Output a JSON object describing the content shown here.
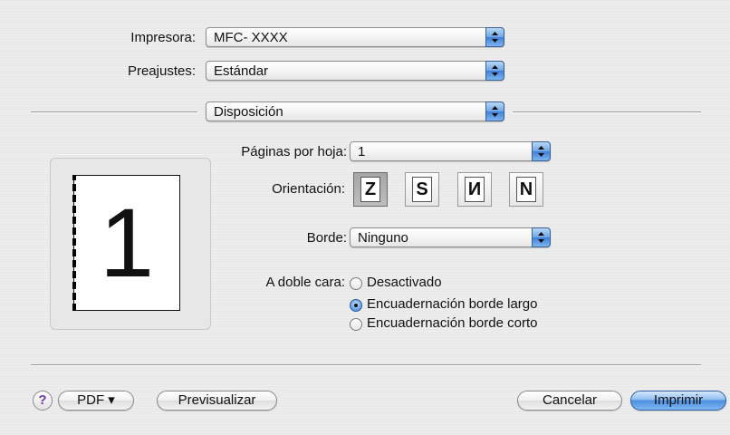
{
  "printer": {
    "label": "Impresora:",
    "value": "MFC- XXXX"
  },
  "presets": {
    "label": "Preajustes:",
    "value": "Estándar"
  },
  "panel": {
    "value": "Disposición"
  },
  "layout": {
    "pages_per_sheet": {
      "label": "Páginas por hoja:",
      "value": "1"
    },
    "orientation": {
      "label": "Orientación:",
      "options": [
        "Z",
        "S",
        "N",
        "N"
      ],
      "selected_index": 0
    },
    "border": {
      "label": "Borde:",
      "value": "Ninguno"
    },
    "duplex": {
      "label": "A doble cara:",
      "options": [
        "Desactivado",
        "Encuadernación borde largo",
        "Encuadernación borde corto"
      ],
      "selected_index": 1
    }
  },
  "preview": {
    "page_number": "1"
  },
  "footer": {
    "help_glyph": "?",
    "pdf_label": "PDF ▾",
    "preview_label": "Previsualizar",
    "cancel_label": "Cancelar",
    "print_label": "Imprimir"
  },
  "colors": {
    "accent_blue": "#4b8fe0",
    "background": "#ececec"
  }
}
